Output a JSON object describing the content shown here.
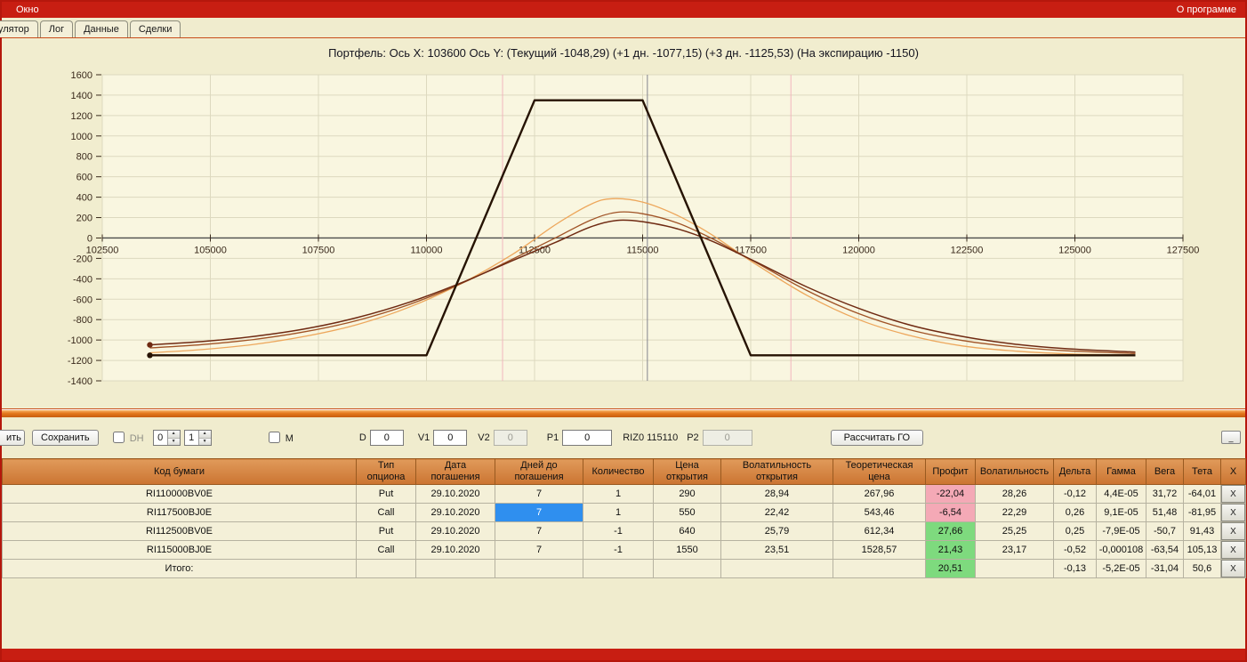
{
  "menubar": {
    "window_label": "Окно",
    "about_label": "О программе"
  },
  "tabs": [
    {
      "label": "кулятор"
    },
    {
      "label": "Лог"
    },
    {
      "label": "Данные"
    },
    {
      "label": "Сделки"
    }
  ],
  "chart_data": {
    "type": "line",
    "title": "Портфель:  Ось X:  103600  Ось Y:   (Текущий -1048,29)   (+1 дн. -1077,15)   (+3 дн. -1125,53)   (На экспирацию -1150)",
    "xlim": [
      102500,
      127500
    ],
    "ylim": [
      -1400,
      1600
    ],
    "grid": true,
    "legend": "none",
    "cursor_x": 103600,
    "x_ticks": [
      102500,
      105000,
      107500,
      110000,
      112500,
      115000,
      117500,
      120000,
      122500,
      125000,
      127500
    ],
    "y_ticks": [
      1600,
      1400,
      1200,
      1000,
      800,
      600,
      400,
      200,
      0,
      -200,
      -400,
      -600,
      -800,
      -1000,
      -1200,
      -1400
    ],
    "vlines": [
      {
        "x": 111760,
        "color": "#f2b6bd"
      },
      {
        "x": 115110,
        "color": "#84848e"
      },
      {
        "x": 118430,
        "color": "#f2b6bd"
      }
    ],
    "series": [
      {
        "name": "+3 дн.",
        "color": "#eda75c",
        "width": 1.3,
        "smooth": true,
        "marker": false,
        "points": [
          [
            103600,
            -1125
          ],
          [
            104800,
            -1094
          ],
          [
            106000,
            -1043
          ],
          [
            107200,
            -963
          ],
          [
            108400,
            -848
          ],
          [
            109600,
            -678
          ],
          [
            110800,
            -448
          ],
          [
            112000,
            -158
          ],
          [
            113000,
            135
          ],
          [
            113800,
            330
          ],
          [
            114300,
            385
          ],
          [
            115000,
            352
          ],
          [
            115800,
            222
          ],
          [
            116600,
            32
          ],
          [
            117600,
            -252
          ],
          [
            118800,
            -562
          ],
          [
            120000,
            -800
          ],
          [
            121200,
            -958
          ],
          [
            122400,
            -1058
          ],
          [
            123600,
            -1108
          ],
          [
            124800,
            -1135
          ],
          [
            126400,
            -1148
          ]
        ]
      },
      {
        "name": "+1 дн.",
        "color": "#a05326",
        "width": 1.3,
        "smooth": true,
        "marker": false,
        "points": [
          [
            103600,
            -1077
          ],
          [
            104800,
            -1045
          ],
          [
            106000,
            -995
          ],
          [
            107200,
            -918
          ],
          [
            108400,
            -808
          ],
          [
            109600,
            -652
          ],
          [
            110800,
            -448
          ],
          [
            112000,
            -205
          ],
          [
            113000,
            5
          ],
          [
            113800,
            175
          ],
          [
            114400,
            252
          ],
          [
            115000,
            238
          ],
          [
            115800,
            148
          ],
          [
            116600,
            -5
          ],
          [
            117600,
            -235
          ],
          [
            118800,
            -515
          ],
          [
            120000,
            -742
          ],
          [
            121200,
            -902
          ],
          [
            122400,
            -1005
          ],
          [
            123600,
            -1068
          ],
          [
            124800,
            -1105
          ],
          [
            126400,
            -1132
          ]
        ]
      },
      {
        "name": "Текущий",
        "color": "#6f2a12",
        "width": 1.5,
        "smooth": true,
        "marker": true,
        "points": [
          [
            103600,
            -1048
          ],
          [
            104800,
            -1015
          ],
          [
            106000,
            -965
          ],
          [
            107200,
            -890
          ],
          [
            108400,
            -780
          ],
          [
            109600,
            -630
          ],
          [
            110800,
            -440
          ],
          [
            112000,
            -220
          ],
          [
            113000,
            -40
          ],
          [
            113800,
            110
          ],
          [
            114400,
            172
          ],
          [
            115000,
            160
          ],
          [
            115800,
            90
          ],
          [
            116600,
            -30
          ],
          [
            117600,
            -230
          ],
          [
            118800,
            -480
          ],
          [
            120000,
            -690
          ],
          [
            121200,
            -855
          ],
          [
            122400,
            -965
          ],
          [
            123600,
            -1040
          ],
          [
            124800,
            -1085
          ],
          [
            126400,
            -1118
          ]
        ]
      },
      {
        "name": "На экспирацию",
        "color": "#261303",
        "width": 2.4,
        "smooth": false,
        "marker": true,
        "points": [
          [
            103600,
            -1150
          ],
          [
            110000,
            -1150
          ],
          [
            112500,
            1350
          ],
          [
            115000,
            1350
          ],
          [
            117500,
            -1150
          ],
          [
            126400,
            -1150
          ]
        ]
      }
    ]
  },
  "controls": {
    "load_button_label": "ить",
    "save_button_label": "Сохранить",
    "dh_checkbox_label": "DH",
    "dh_spinner1_value": "0",
    "dh_spinner2_value": "1",
    "m_checkbox_label": "M",
    "d_label": "D",
    "d_value": "0",
    "v1_label": "V1",
    "v1_value": "0",
    "v2_label": "V2",
    "v2_value": "0",
    "p1_label": "P1",
    "p1_value": "0",
    "instrument_label": "RIZ0 115110",
    "p2_label": "P2",
    "p2_value": "0",
    "calc_go_button_label": "Рассчитать ГО",
    "collapse_button_label": "_"
  },
  "colors": {
    "titlebar_red": "#c81e12",
    "splitter_orange": "#e4781c",
    "header_orange": "#cd7733",
    "profit_negative_bg": "#f4a9b6",
    "profit_positive_bg": "#7eda7e",
    "selected_cell_bg": "#2f8fef"
  },
  "table": {
    "headers": [
      "Код бумаги",
      "Тип\nопциона",
      "Дата\nпогашения",
      "Дней до\nпогашения",
      "Количество",
      "Цена\nоткрытия",
      "Волатильность\nоткрытия",
      "Теоретическая\nцена",
      "Профит",
      "Волатильность",
      "Дельта",
      "Гамма",
      "Вега",
      "Тета",
      "X"
    ],
    "x_button_label": "X",
    "rows": [
      {
        "cells": [
          "RI110000BV0E",
          "Put",
          "29.10.2020",
          "7",
          "1",
          "290",
          "28,94",
          "267,96",
          "-22,04",
          "28,26",
          "-0,12",
          "4,4E-05",
          "31,72",
          "-64,01"
        ],
        "profit_class": "neg",
        "selected_cell": -1,
        "total": false
      },
      {
        "cells": [
          "RI117500BJ0E",
          "Call",
          "29.10.2020",
          "7",
          "1",
          "550",
          "22,42",
          "543,46",
          "-6,54",
          "22,29",
          "0,26",
          "9,1E-05",
          "51,48",
          "-81,95"
        ],
        "profit_class": "neg",
        "selected_cell": 3,
        "total": false
      },
      {
        "cells": [
          "RI112500BV0E",
          "Put",
          "29.10.2020",
          "7",
          "-1",
          "640",
          "25,79",
          "612,34",
          "27,66",
          "25,25",
          "0,25",
          "-7,9E-05",
          "-50,7",
          "91,43"
        ],
        "profit_class": "pos",
        "selected_cell": -1,
        "total": false
      },
      {
        "cells": [
          "RI115000BJ0E",
          "Call",
          "29.10.2020",
          "7",
          "-1",
          "1550",
          "23,51",
          "1528,57",
          "21,43",
          "23,17",
          "-0,52",
          "-0,000108",
          "-63,54",
          "105,13"
        ],
        "profit_class": "pos",
        "selected_cell": -1,
        "total": false
      },
      {
        "cells": [
          "Итого:",
          "",
          "",
          "",
          "",
          "",
          "",
          "",
          "20,51",
          "",
          "-0,13",
          "-5,2E-05",
          "-31,04",
          "50,6"
        ],
        "profit_class": "pos",
        "selected_cell": -1,
        "total": true
      }
    ]
  }
}
